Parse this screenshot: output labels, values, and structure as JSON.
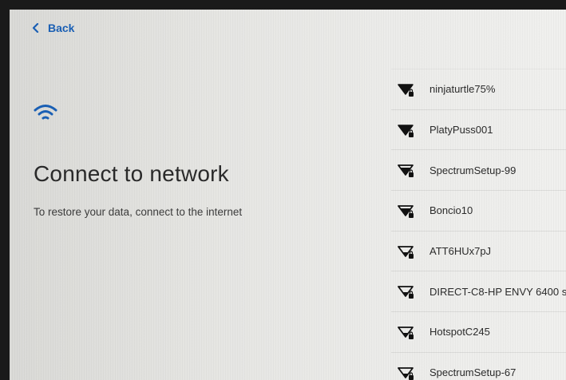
{
  "header": {
    "back_label": "Back"
  },
  "main": {
    "title": "Connect to network",
    "subtitle": "To restore your data, connect to the internet"
  },
  "networks": [
    {
      "name": "ninjaturtle75%",
      "signal": "full",
      "secured": true
    },
    {
      "name": "PlatyPuss001",
      "signal": "full",
      "secured": true
    },
    {
      "name": "SpectrumSetup-99",
      "signal": "medium",
      "secured": true
    },
    {
      "name": "Boncio10",
      "signal": "medium",
      "secured": true
    },
    {
      "name": "ATT6HUx7pJ",
      "signal": "low",
      "secured": true
    },
    {
      "name": "DIRECT-C8-HP ENVY 6400 s",
      "signal": "low",
      "secured": true
    },
    {
      "name": "HotspotC245",
      "signal": "low",
      "secured": true
    },
    {
      "name": "SpectrumSetup-67",
      "signal": "low",
      "secured": true
    }
  ],
  "colors": {
    "accent": "#1a5fb4",
    "text": "#2a2a2a"
  },
  "icons": {
    "back": "chevron-left-icon",
    "header": "wifi-icon",
    "network": "wifi-lock-icon"
  }
}
